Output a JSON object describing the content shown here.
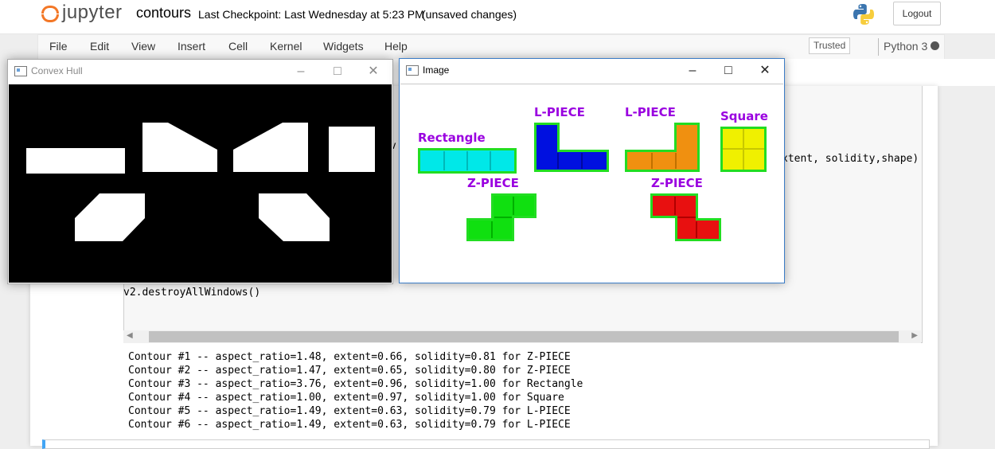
{
  "header": {
    "logo_text": "jupyter",
    "notebook_name": "contours",
    "checkpoint": "Last Checkpoint: Last Wednesday at 5:23 PM",
    "status": "(unsaved changes)",
    "logout_label": "Logout"
  },
  "menu": {
    "items": [
      "File",
      "Edit",
      "View",
      "Insert",
      "Cell",
      "Kernel",
      "Widgets",
      "Help"
    ],
    "trusted": "Trusted",
    "kernel": "Python 3"
  },
  "code": {
    "partial_line_1": "v",
    "partial_line_2": "xtent, solidity,shape)",
    "partial_line_3": "v2.destroyAllWindows()"
  },
  "output": {
    "lines": [
      "Contour #1 -- aspect_ratio=1.48, extent=0.66, solidity=0.81 for Z-PIECE",
      "Contour #2 -- aspect_ratio=1.47, extent=0.65, solidity=0.80 for Z-PIECE",
      "Contour #3 -- aspect_ratio=3.76, extent=0.96, solidity=1.00 for Rectangle",
      "Contour #4 -- aspect_ratio=1.00, extent=0.97, solidity=1.00 for Square",
      "Contour #5 -- aspect_ratio=1.49, extent=0.63, solidity=0.79 for L-PIECE",
      "Contour #6 -- aspect_ratio=1.49, extent=0.63, solidity=0.79 for L-PIECE"
    ]
  },
  "windows": {
    "hull": {
      "title": "Convex Hull"
    },
    "image": {
      "title": "Image",
      "labels": {
        "rectangle": "Rectangle",
        "l_piece_1": "L-PIECE",
        "l_piece_2": "L-PIECE",
        "square": "Square",
        "z_piece_1": "Z-PIECE",
        "z_piece_2": "Z-PIECE"
      }
    }
  },
  "colors": {
    "label": "#9a00e0",
    "outline": "#22dd22",
    "rectangle": "#00e8e8",
    "l_piece_blue": "#0010e0",
    "l_piece_orange": "#f09010",
    "square": "#f0f000",
    "z_piece_green": "#10e010",
    "z_piece_red": "#e81010",
    "jupyter_orange": "#f37726"
  },
  "icons": {
    "minimize": "minimize-icon",
    "maximize": "maximize-icon",
    "close": "close-icon"
  }
}
